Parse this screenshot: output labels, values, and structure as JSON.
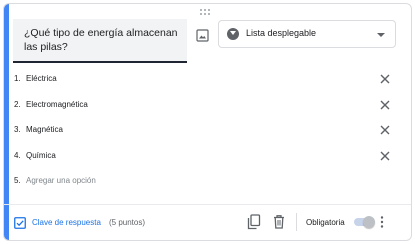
{
  "question": {
    "title": "¿Qué tipo de energía almacenan las pilas?",
    "type_label": "Lista desplegable"
  },
  "options": [
    {
      "number": "1.",
      "label": "Eléctrica"
    },
    {
      "number": "2.",
      "label": "Electromagnética"
    },
    {
      "number": "3.",
      "label": "Magnética"
    },
    {
      "number": "4.",
      "label": "Química"
    }
  ],
  "add_option": {
    "number": "5.",
    "label": "Agregar una opción"
  },
  "footer": {
    "answer_key_label": "Clave de respuesta",
    "points": "(5 puntos)",
    "required_label": "Obligatoria",
    "required_on": true
  },
  "colors": {
    "accent": "#4285f4",
    "link": "#1a73e8"
  },
  "icons": [
    "drag-handle-icon",
    "image-icon",
    "dropdown-type-icon",
    "chevron-down-icon",
    "close-icon",
    "checkbox-icon",
    "copy-icon",
    "trash-icon",
    "more-vert-icon"
  ]
}
